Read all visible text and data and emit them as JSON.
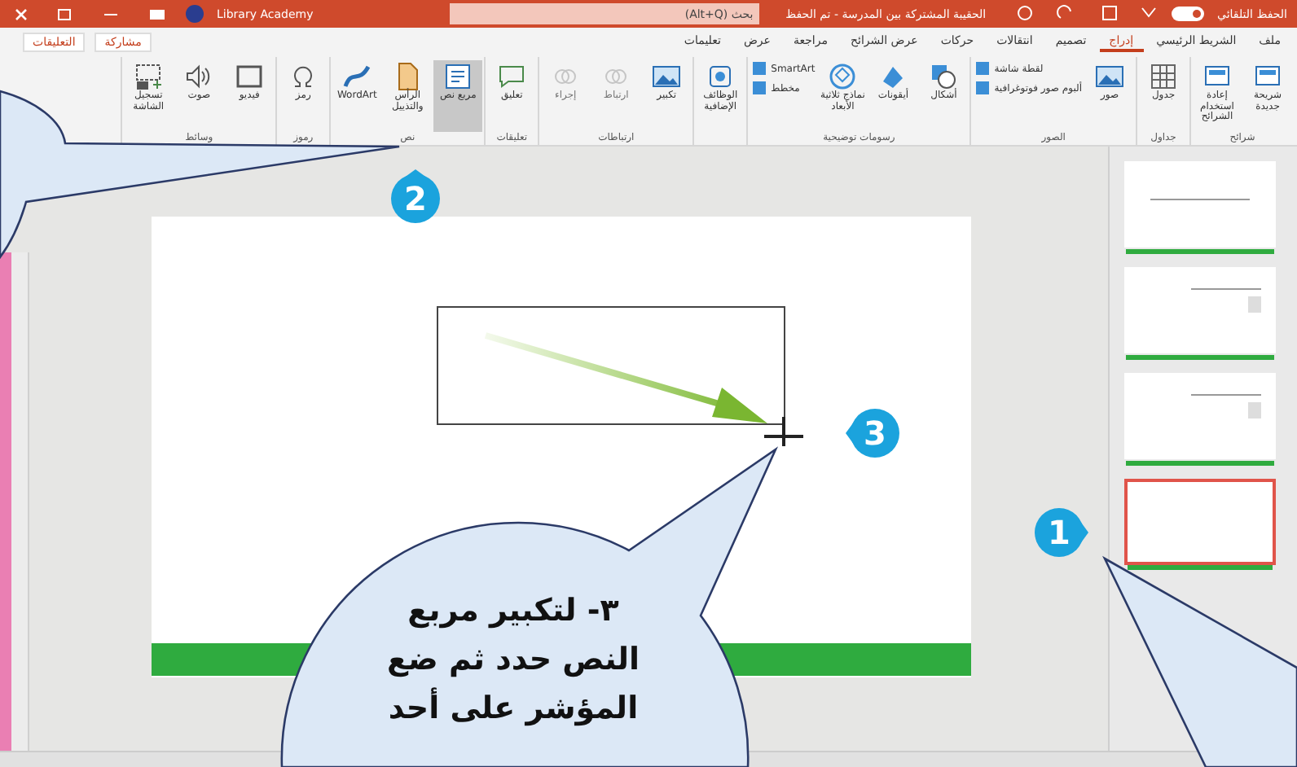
{
  "title_bar": {
    "account": "Library Academy",
    "search_placeholder": "بحث (Alt+Q)",
    "document_title": "الحقيبة المشتركة بين المدرسة - تم الحفظ",
    "autosave_label": "الحفظ التلقائي",
    "autosave_on": true
  },
  "tabs": [
    {
      "label": "ملف",
      "selected": false
    },
    {
      "label": "الشريط الرئيسي",
      "selected": false
    },
    {
      "label": "إدراج",
      "selected": true
    },
    {
      "label": "تصميم",
      "selected": false
    },
    {
      "label": "انتقالات",
      "selected": false
    },
    {
      "label": "حركات",
      "selected": false
    },
    {
      "label": "عرض الشرائح",
      "selected": false
    },
    {
      "label": "مراجعة",
      "selected": false
    },
    {
      "label": "عرض",
      "selected": false
    },
    {
      "label": "تعليمات",
      "selected": false
    }
  ],
  "share_buttons": [
    {
      "label": "مشاركة"
    },
    {
      "label": "التعليقات"
    }
  ],
  "ribbon_groups": [
    {
      "name": "شرائح",
      "buttons": [
        {
          "label": "شريحة جديدة",
          "kind": "large",
          "selected": false,
          "disabled": false
        },
        {
          "label": "إعادة استخدام الشرائح",
          "kind": "large",
          "selected": false,
          "disabled": false
        }
      ]
    },
    {
      "name": "جداول",
      "buttons": [
        {
          "label": "جدول",
          "kind": "large",
          "selected": false,
          "disabled": false
        }
      ]
    },
    {
      "name": "الصور",
      "buttons": [
        {
          "label": "صور",
          "kind": "large",
          "selected": false,
          "disabled": false
        },
        {
          "label": "لقطة شاشة",
          "kind": "small",
          "selected": false,
          "disabled": false
        },
        {
          "label": "ألبوم صور فوتوغرافية",
          "kind": "small",
          "selected": false,
          "disabled": false
        }
      ]
    },
    {
      "name": "رسومات توضيحية",
      "buttons": [
        {
          "label": "أشكال",
          "kind": "large",
          "selected": false,
          "disabled": false
        },
        {
          "label": "أيقونات",
          "kind": "large",
          "selected": false,
          "disabled": false
        },
        {
          "label": "نماذج ثلاثية الأبعاد",
          "kind": "large",
          "selected": false,
          "disabled": false
        },
        {
          "label": "SmartArt",
          "kind": "small",
          "selected": false,
          "disabled": false
        },
        {
          "label": "مخطط",
          "kind": "small",
          "selected": false,
          "disabled": false
        }
      ]
    },
    {
      "buttons": [
        {
          "label": "الوظائف الإضافية",
          "kind": "large",
          "selected": false,
          "disabled": false
        }
      ]
    },
    {
      "name": "ارتباطات",
      "buttons": [
        {
          "label": "تكبير",
          "kind": "large",
          "selected": false,
          "disabled": false
        },
        {
          "label": "ارتباط",
          "kind": "large",
          "selected": false,
          "disabled": true
        },
        {
          "label": "إجراء",
          "kind": "large",
          "selected": false,
          "disabled": true
        }
      ]
    },
    {
      "name": "تعليقات",
      "buttons": [
        {
          "label": "تعليق",
          "kind": "large",
          "selected": false,
          "disabled": false
        }
      ]
    },
    {
      "name": "نص",
      "buttons": [
        {
          "label": "مربع نص",
          "kind": "large",
          "selected": true,
          "disabled": false
        },
        {
          "label": "الرأس والتذييل",
          "kind": "large",
          "selected": false,
          "disabled": false
        },
        {
          "label": "WordArt",
          "kind": "large",
          "selected": false,
          "disabled": false
        }
      ]
    },
    {
      "name": "رموز",
      "buttons": [
        {
          "label": "رمز",
          "kind": "large",
          "selected": false,
          "disabled": false
        }
      ]
    },
    {
      "name": "وسائط",
      "buttons": [
        {
          "label": "فيديو",
          "kind": "large",
          "selected": false,
          "disabled": false
        },
        {
          "label": "صوت",
          "kind": "large",
          "selected": false,
          "disabled": false
        },
        {
          "label": "تسجيل الشاشة",
          "kind": "large",
          "selected": false,
          "disabled": false
        }
      ]
    }
  ],
  "thumbnails": [
    {
      "selected": false
    },
    {
      "selected": false
    },
    {
      "selected": false
    },
    {
      "selected": true
    }
  ],
  "badges": [
    {
      "number": "1"
    },
    {
      "number": "2"
    },
    {
      "number": "3"
    }
  ],
  "callout_text": [
    "٣- لتكبير مربع",
    "النص حدد ثم ضع",
    "المؤشر على أحد"
  ]
}
